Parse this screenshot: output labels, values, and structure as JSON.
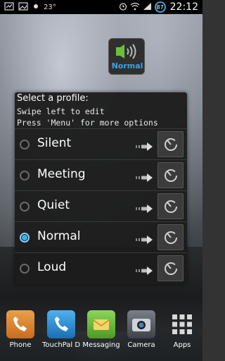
{
  "status_bar": {
    "temperature": "23°",
    "battery_level": "87",
    "time": "22:12"
  },
  "widget": {
    "label": "Normal",
    "icon": "speaker-signal-icon"
  },
  "dialog": {
    "title": "Select a profile:",
    "hint_line1": "Swipe left to edit",
    "hint_line2": "Press 'Menu' for more options",
    "profiles": [
      {
        "label": "Silent",
        "selected": false
      },
      {
        "label": "Meeting",
        "selected": false
      },
      {
        "label": "Quiet",
        "selected": false
      },
      {
        "label": "Normal",
        "selected": true
      },
      {
        "label": "Loud",
        "selected": false
      }
    ]
  },
  "dock": {
    "items": [
      {
        "label": "Phone",
        "icon": "phone-contact-icon",
        "color": "#e08a2e"
      },
      {
        "label": "TouchPal D",
        "icon": "touchpal-phone-icon",
        "color": "#2a8fd6"
      },
      {
        "label": "Messaging",
        "icon": "messaging-icon",
        "color": "#6cbf3a"
      },
      {
        "label": "Camera",
        "icon": "camera-icon",
        "color": "#555a62"
      },
      {
        "label": "Apps",
        "icon": "apps-grid-icon",
        "color": "#cccccc"
      }
    ]
  },
  "colors": {
    "accent": "#33b5e5",
    "dialog_bg": "#1c1c1c"
  }
}
